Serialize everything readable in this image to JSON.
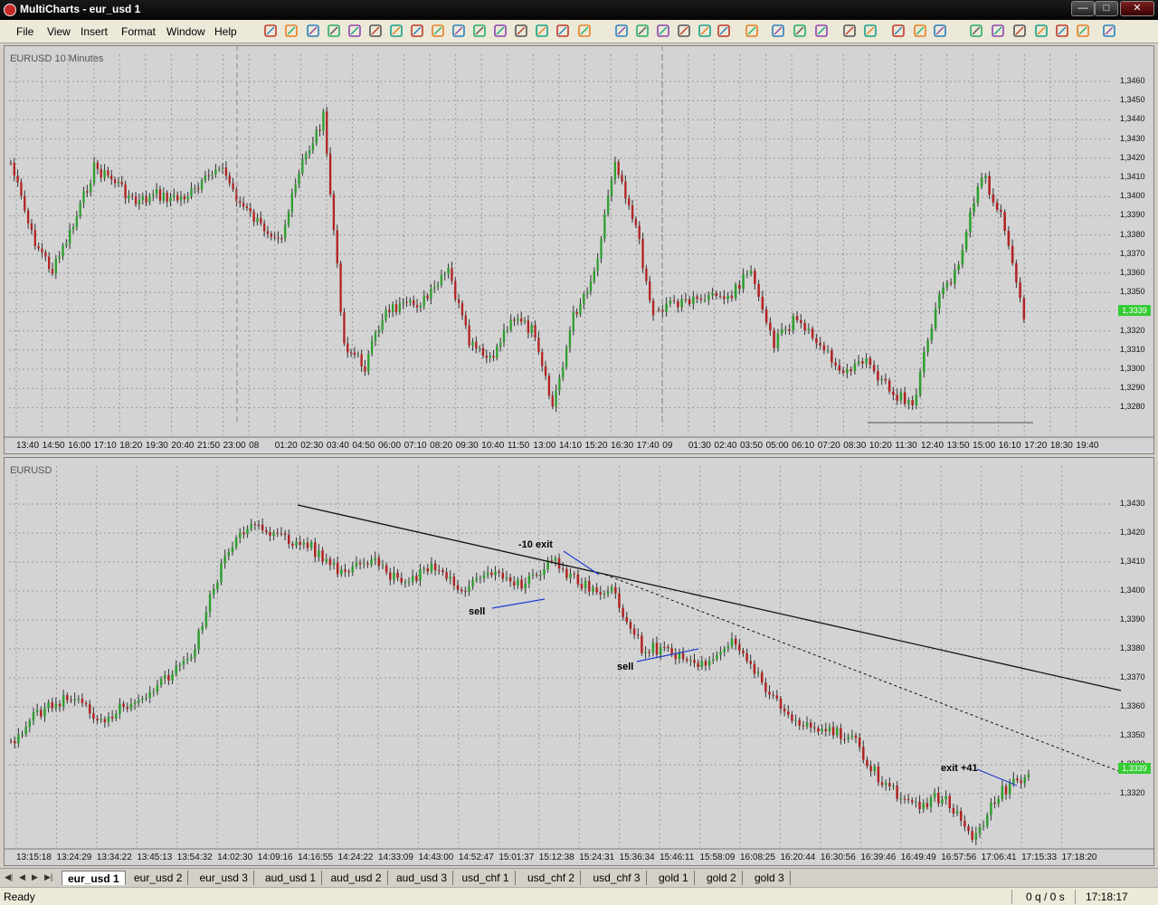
{
  "window": {
    "title": "MultiCharts - eur_usd 1",
    "minimize": "—",
    "maximize": "□",
    "close": "✕"
  },
  "menu": [
    "File",
    "View",
    "Insert",
    "Format",
    "Window",
    "Help"
  ],
  "chart1": {
    "label": "EURUSD  10 Minutes",
    "price_labels": [
      "1,3460",
      "1,3450",
      "1,3440",
      "1,3430",
      "1,3420",
      "1,3410",
      "1,3400",
      "1,3390",
      "1,3380",
      "1,3370",
      "1,3360",
      "1,3350",
      "1,3330",
      "1,3320",
      "1,3310",
      "1,3300",
      "1,3290",
      "1,3280"
    ],
    "last_price": "1,3339",
    "time_labels": [
      "13:40",
      "14:50",
      "16:00",
      "17:10",
      "18:20",
      "19:30",
      "20:40",
      "21:50",
      "23:00",
      "08",
      "01:20",
      "02:30",
      "03:40",
      "04:50",
      "06:00",
      "07:10",
      "08:20",
      "09:30",
      "10:40",
      "11:50",
      "13:00",
      "14:10",
      "15:20",
      "16:30",
      "17:40",
      "09",
      "01:30",
      "02:40",
      "03:50",
      "05:00",
      "06:10",
      "07:20",
      "08:30",
      "10:20",
      "11:30",
      "12:40",
      "13:50",
      "15:00",
      "16:10",
      "17:20",
      "18:30",
      "19:40"
    ]
  },
  "chart2": {
    "label": "EURUSD",
    "price_labels": [
      "1,3430",
      "1,3420",
      "1,3410",
      "1,3400",
      "1,3390",
      "1,3380",
      "1,3370",
      "1,3360",
      "1,3350",
      "1,3330",
      "1,3320"
    ],
    "last_price": "1,3339",
    "time_labels": [
      "13:15:18",
      "13:24:29",
      "13:34:22",
      "13:45:13",
      "13:54:32",
      "14:02:30",
      "14:09:16",
      "14:16:55",
      "14:24:22",
      "14:33:09",
      "14:43:00",
      "14:52:47",
      "15:01:37",
      "15:12:38",
      "15:24:31",
      "15:36:34",
      "15:46:11",
      "15:58:09",
      "16:08:25",
      "16:20:44",
      "16:30:56",
      "16:39:46",
      "16:49:49",
      "16:57:56",
      "17:06:41",
      "17:15:33",
      "17:18:20"
    ],
    "annotations": {
      "exit_loss": "-10 exit",
      "sell1": "sell",
      "sell2": "sell",
      "exit_win": "exit +41"
    }
  },
  "tabs": [
    "eur_usd 1",
    "eur_usd 2",
    "eur_usd 3",
    "aud_usd 1",
    "aud_usd 2",
    "aud_usd 3",
    "usd_chf 1",
    "usd_chf 2",
    "usd_chf 3",
    "gold 1",
    "gold 2",
    "gold 3"
  ],
  "status": {
    "state": "Ready",
    "queue": "0 q / 0 s",
    "clock": "17:18:17"
  }
}
